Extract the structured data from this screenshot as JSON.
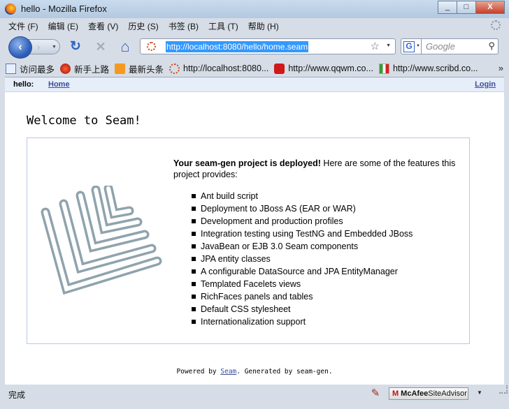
{
  "window": {
    "title": "hello - Mozilla Firefox",
    "buttons": [
      "_",
      "□",
      "X"
    ]
  },
  "menubar": {
    "items": [
      "文件 (F)",
      "编辑 (E)",
      "查看 (V)",
      "历史 (S)",
      "书签 (B)",
      "工具 (T)",
      "帮助 (H)"
    ]
  },
  "navbar": {
    "back": "‹",
    "forward": "›",
    "reload": "↻",
    "stop": "✕",
    "home": "⌂",
    "url": "http://localhost:8080/hello/home.seam",
    "search_placeholder": "Google"
  },
  "bookmarks": {
    "items": [
      "访问最多",
      "新手上路",
      "最新头条",
      "http://localhost:8080...",
      "http://www.qqwm.co...",
      "http://www.scribd.co..."
    ],
    "more": "»"
  },
  "page": {
    "menu": {
      "app_label": "hello:",
      "home_link": "Home",
      "login_link": "Login"
    },
    "welcome": "Welcome to Seam!",
    "deploy_bold": "Your seam-gen project is deployed!",
    "deploy_rest": " Here are some of the features this project provides:",
    "features": [
      "Ant build script",
      "Deployment to JBoss AS (EAR or WAR)",
      "Development and production profiles",
      "Integration testing using TestNG and Embedded JBoss",
      "JavaBean or EJB 3.0 Seam components",
      "JPA entity classes",
      "A configurable DataSource and JPA EntityManager",
      "Templated Facelets views",
      "RichFaces panels and tables",
      "Default CSS stylesheet",
      "Internationalization support"
    ],
    "footer": {
      "prefix": "Powered by ",
      "link": "Seam",
      "suffix": ". Generated by seam-gen."
    }
  },
  "status": {
    "text": "完成",
    "siteadvisor_brand": "McAfee",
    "siteadvisor_label": "SiteAdvisor"
  },
  "colors": {
    "link": "#3b4c9a",
    "selection": "#3399ff",
    "mcafee_red": "#c0101a"
  }
}
